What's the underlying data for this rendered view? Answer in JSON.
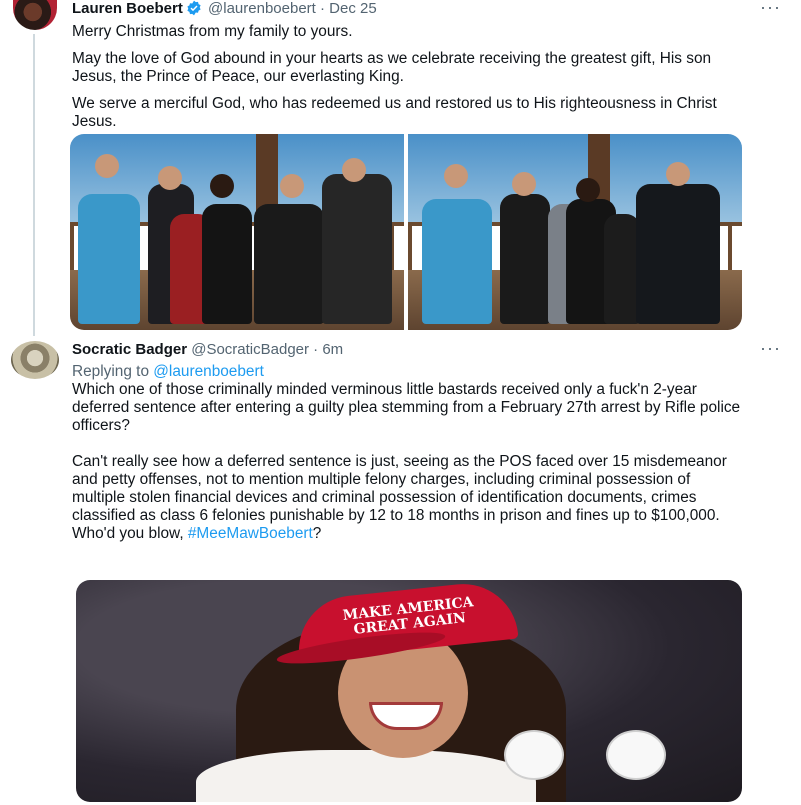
{
  "original_tweet": {
    "author_name": "Lauren Boebert",
    "author_handle": "@laurenboebert",
    "date": "· Dec 25",
    "more": "···",
    "paragraphs": [
      "Merry Christmas from my family to yours.",
      "May the love of God abound in your hearts as we celebrate receiving the greatest gift, His son Jesus, the Prince of Peace, our everlasting King.",
      "We serve a merciful God, who has redeemed us and restored us to His righteousness in Christ Jesus."
    ]
  },
  "reply_tweet": {
    "author_name": "Socratic Badger",
    "author_handle": "@SocraticBadger",
    "time": "· 6m",
    "more": "···",
    "replying_prefix": "Replying to",
    "replying_to": "@laurenboebert",
    "paragraph1": "Which one of those criminally minded verminous little bastards received only a fuck'n 2-year deferred sentence after entering a guilty plea stemming from a February 27th arrest by Rifle police officers?",
    "paragraph2": "Can't really see how a deferred sentence is just, seeing as the POS faced over 15 misdemeanor and petty offenses, not to mention multiple felony charges, including criminal possession of multiple stolen financial devices and criminal possession of identification documents, crimes classified as class 6 felonies punishable by 12 to 18 months in prison and fines up to $100,000.",
    "last_line_prefix": "Who'd you blow,",
    "hashtag": "#MeeMawBoebert",
    "last_line_suffix": "?"
  },
  "cap_text": "MAKE AMERICA GREAT AGAIN",
  "colors": {
    "link": "#1d9bf0",
    "secondary_text": "#536471",
    "verified": "#1d9bf0"
  }
}
